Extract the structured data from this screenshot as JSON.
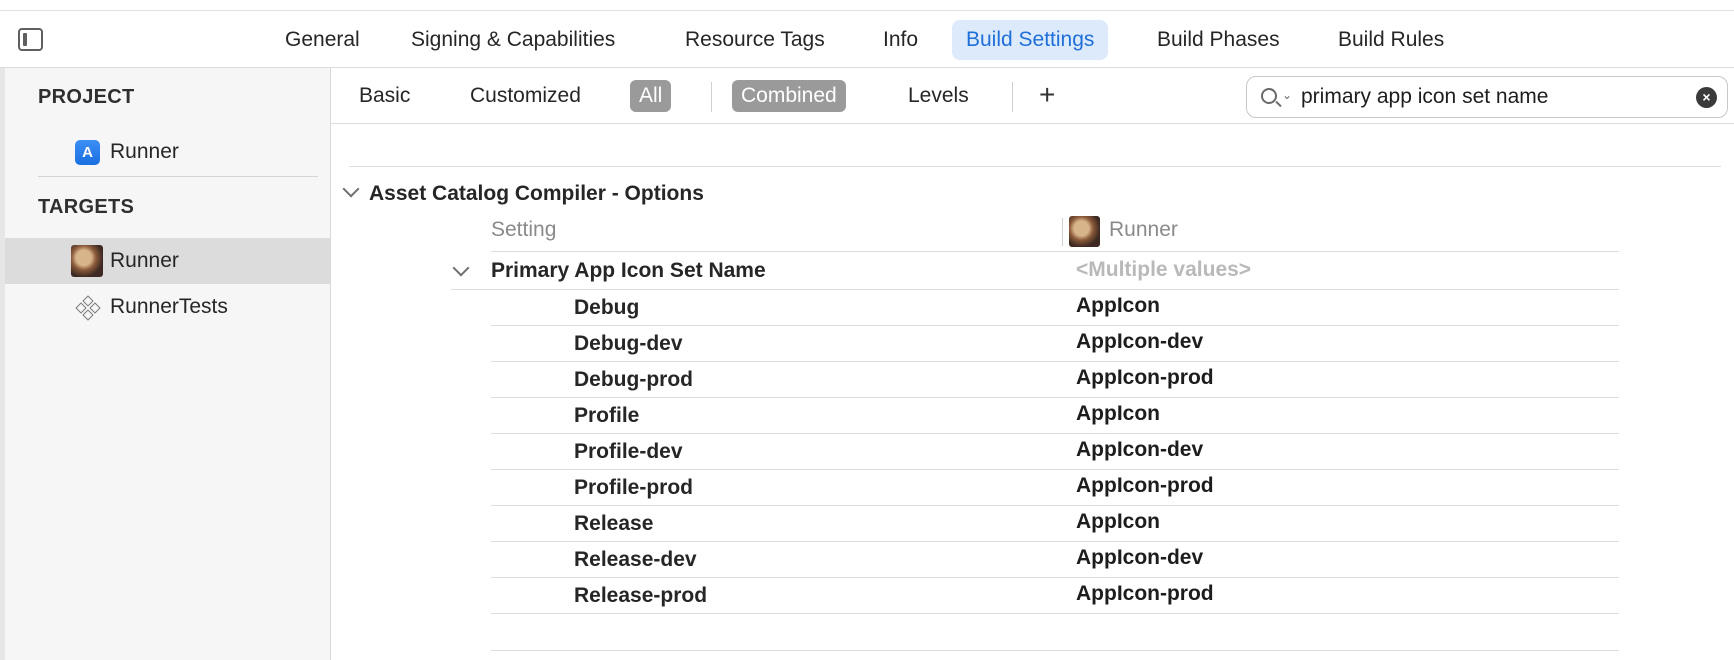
{
  "tabs": [
    {
      "label": "General"
    },
    {
      "label": "Signing & Capabilities"
    },
    {
      "label": "Resource Tags"
    },
    {
      "label": "Info"
    },
    {
      "label": "Build Settings"
    },
    {
      "label": "Build Phases"
    },
    {
      "label": "Build Rules"
    }
  ],
  "active_tab": "Build Settings",
  "accent_color": "#1f6fd8",
  "sidebar": {
    "project_header": "PROJECT",
    "project_item": "Runner",
    "targets_header": "TARGETS",
    "targets": [
      {
        "label": "Runner",
        "icon": "app-photo-icon"
      },
      {
        "label": "RunnerTests",
        "icon": "test-bundle-icon"
      }
    ]
  },
  "filters": {
    "basic": "Basic",
    "customized": "Customized",
    "all": "All",
    "combined": "Combined",
    "levels": "Levels",
    "add": "+"
  },
  "search": {
    "value": "primary app icon set name"
  },
  "content": {
    "group_title": "Asset Catalog Compiler - Options",
    "column_setting": "Setting",
    "column_target": "Runner",
    "setting_name": "Primary App Icon Set Name",
    "setting_value": "<Multiple values>",
    "rows": [
      {
        "config": "Debug",
        "value": "AppIcon"
      },
      {
        "config": "Debug-dev",
        "value": "AppIcon-dev"
      },
      {
        "config": "Debug-prod",
        "value": "AppIcon-prod"
      },
      {
        "config": "Profile",
        "value": "AppIcon"
      },
      {
        "config": "Profile-dev",
        "value": "AppIcon-dev"
      },
      {
        "config": "Profile-prod",
        "value": "AppIcon-prod"
      },
      {
        "config": "Release",
        "value": "AppIcon"
      },
      {
        "config": "Release-dev",
        "value": "AppIcon-dev"
      },
      {
        "config": "Release-prod",
        "value": "AppIcon-prod"
      }
    ]
  }
}
